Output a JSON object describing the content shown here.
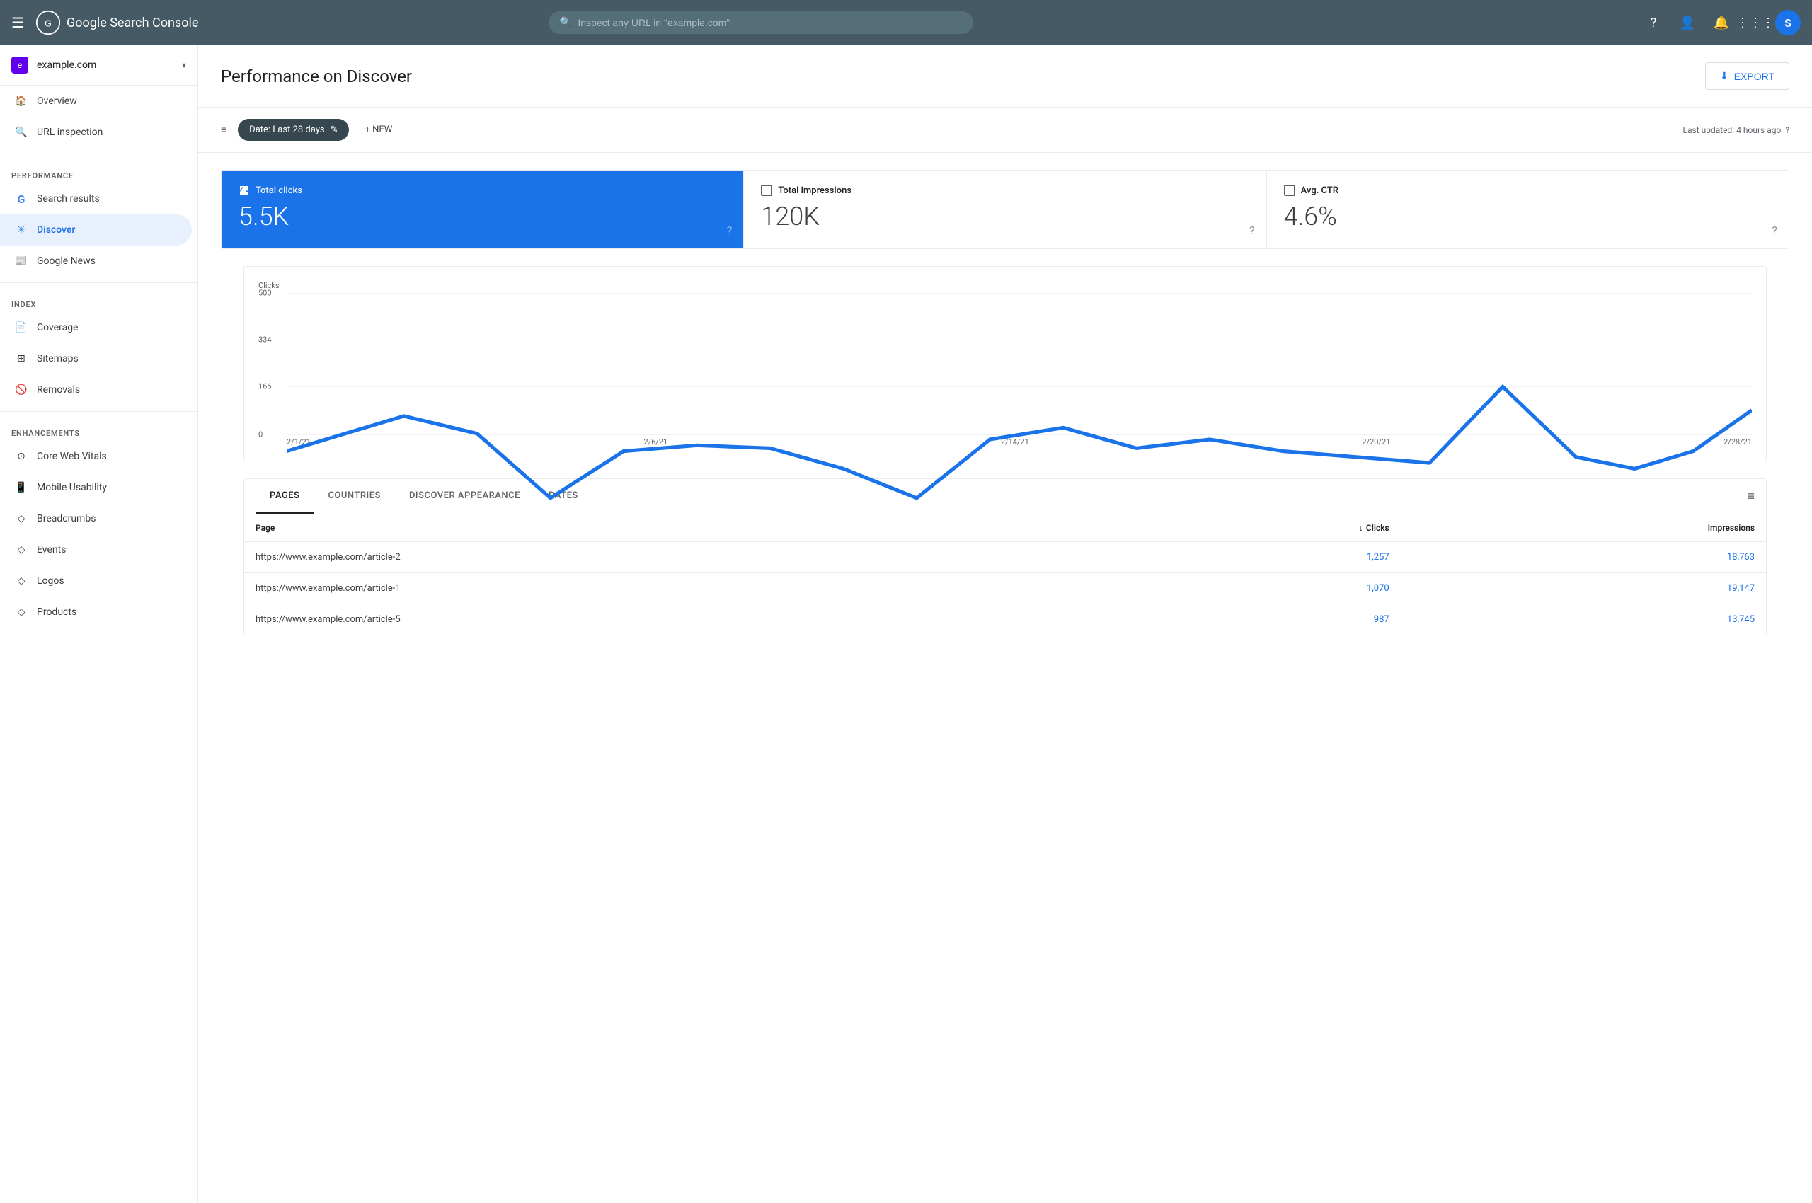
{
  "header": {
    "menu_icon": "☰",
    "logo_text": "Google Search Console",
    "search_placeholder": "Inspect any URL in \"example.com\"",
    "help_icon": "?",
    "avatar_letter": "S"
  },
  "sidebar": {
    "property": {
      "icon_letter": "e",
      "name": "example.com",
      "chevron": "▾"
    },
    "nav_items": [
      {
        "id": "overview",
        "label": "Overview",
        "icon": "home"
      },
      {
        "id": "url-inspection",
        "label": "URL inspection",
        "icon": "search"
      }
    ],
    "sections": [
      {
        "label": "Performance",
        "items": [
          {
            "id": "search-results",
            "label": "Search results",
            "icon": "G"
          },
          {
            "id": "discover",
            "label": "Discover",
            "icon": "✳",
            "active": true
          },
          {
            "id": "google-news",
            "label": "Google News",
            "icon": "newspaper"
          }
        ]
      },
      {
        "label": "Index",
        "items": [
          {
            "id": "coverage",
            "label": "Coverage",
            "icon": "file"
          },
          {
            "id": "sitemaps",
            "label": "Sitemaps",
            "icon": "grid"
          },
          {
            "id": "removals",
            "label": "Removals",
            "icon": "eye-off"
          }
        ]
      },
      {
        "label": "Enhancements",
        "items": [
          {
            "id": "core-web-vitals",
            "label": "Core Web Vitals",
            "icon": "gauge"
          },
          {
            "id": "mobile-usability",
            "label": "Mobile Usability",
            "icon": "phone"
          },
          {
            "id": "breadcrumbs",
            "label": "Breadcrumbs",
            "icon": "diamond"
          },
          {
            "id": "events",
            "label": "Events",
            "icon": "diamond"
          },
          {
            "id": "logos",
            "label": "Logos",
            "icon": "diamond"
          },
          {
            "id": "products",
            "label": "Products",
            "icon": "diamond"
          }
        ]
      }
    ]
  },
  "page": {
    "title": "Performance on Discover",
    "export_label": "EXPORT"
  },
  "filters": {
    "filter_icon": "≡",
    "date_label": "Date: Last 28 days",
    "edit_icon": "✎",
    "new_label": "+ NEW",
    "last_updated": "Last updated: 4 hours ago",
    "help_icon": "?"
  },
  "metrics": [
    {
      "id": "total-clicks",
      "label": "Total clicks",
      "value": "5.5K",
      "active": true,
      "checked": true
    },
    {
      "id": "total-impressions",
      "label": "Total impressions",
      "value": "120K",
      "active": false,
      "checked": false
    },
    {
      "id": "avg-ctr",
      "label": "Avg. CTR",
      "value": "4.6%",
      "active": false,
      "checked": false
    }
  ],
  "chart": {
    "y_label": "Clicks",
    "y_ticks": [
      "500",
      "334",
      "166",
      "0"
    ],
    "x_labels": [
      "2/1/21",
      "2/6/21",
      "2/14/21",
      "2/20/21",
      "2/28/21"
    ],
    "data_points": [
      {
        "x": 0,
        "y": 0.46
      },
      {
        "x": 0.08,
        "y": 0.58
      },
      {
        "x": 0.13,
        "y": 0.52
      },
      {
        "x": 0.18,
        "y": 0.3
      },
      {
        "x": 0.23,
        "y": 0.46
      },
      {
        "x": 0.28,
        "y": 0.48
      },
      {
        "x": 0.33,
        "y": 0.47
      },
      {
        "x": 0.38,
        "y": 0.4
      },
      {
        "x": 0.43,
        "y": 0.3
      },
      {
        "x": 0.48,
        "y": 0.5
      },
      {
        "x": 0.53,
        "y": 0.54
      },
      {
        "x": 0.58,
        "y": 0.47
      },
      {
        "x": 0.63,
        "y": 0.5
      },
      {
        "x": 0.68,
        "y": 0.46
      },
      {
        "x": 0.73,
        "y": 0.44
      },
      {
        "x": 0.78,
        "y": 0.42
      },
      {
        "x": 0.83,
        "y": 0.68
      },
      {
        "x": 0.88,
        "y": 0.44
      },
      {
        "x": 0.92,
        "y": 0.4
      },
      {
        "x": 0.96,
        "y": 0.46
      },
      {
        "x": 1.0,
        "y": 0.6
      }
    ]
  },
  "table": {
    "tabs": [
      {
        "id": "pages",
        "label": "PAGES",
        "active": true
      },
      {
        "id": "countries",
        "label": "COUNTRIES",
        "active": false
      },
      {
        "id": "discover-appearance",
        "label": "DISCOVER APPEARANCE",
        "active": false
      },
      {
        "id": "dates",
        "label": "DATES",
        "active": false
      }
    ],
    "columns": [
      {
        "id": "page",
        "label": "Page",
        "sortable": false
      },
      {
        "id": "clicks",
        "label": "Clicks",
        "sortable": true,
        "sort_direction": "desc"
      },
      {
        "id": "impressions",
        "label": "Impressions",
        "sortable": false
      }
    ],
    "rows": [
      {
        "page": "https://www.example.com/article-2",
        "clicks": "1,257",
        "impressions": "18,763"
      },
      {
        "page": "https://www.example.com/article-1",
        "clicks": "1,070",
        "impressions": "19,147"
      },
      {
        "page": "https://www.example.com/article-5",
        "clicks": "987",
        "impressions": "13,745"
      }
    ]
  }
}
